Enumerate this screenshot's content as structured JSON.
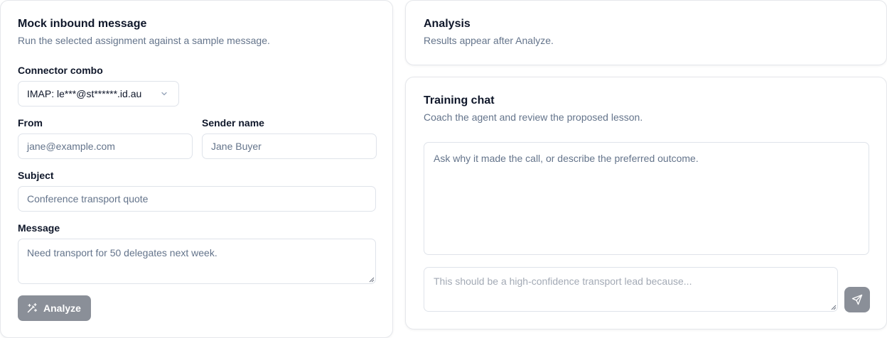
{
  "mock": {
    "title": "Mock inbound message",
    "description": "Run the selected assignment against a sample message.",
    "connector_label": "Connector combo",
    "connector_value": "IMAP: le***@st******.id.au",
    "from_label": "From",
    "from_placeholder": "jane@example.com",
    "sender_label": "Sender name",
    "sender_placeholder": "Jane Buyer",
    "subject_label": "Subject",
    "subject_placeholder": "Conference transport quote",
    "message_label": "Message",
    "message_placeholder": "Need transport for 50 delegates next week.",
    "analyze_label": "Analyze",
    "analyze_icon": "wand-sparkles-icon"
  },
  "analysis": {
    "title": "Analysis",
    "description": "Results appear after Analyze."
  },
  "training": {
    "title": "Training chat",
    "description": "Coach the agent and review the proposed lesson.",
    "chat_placeholder": "Ask why it made the call, or describe the preferred outcome.",
    "input_placeholder": "This should be a high-confidence transport lead because...",
    "send_icon": "send-icon"
  },
  "colors": {
    "button_disabled": "#8a8f98",
    "border": "#dfe3ea",
    "muted_text": "#64748b"
  }
}
